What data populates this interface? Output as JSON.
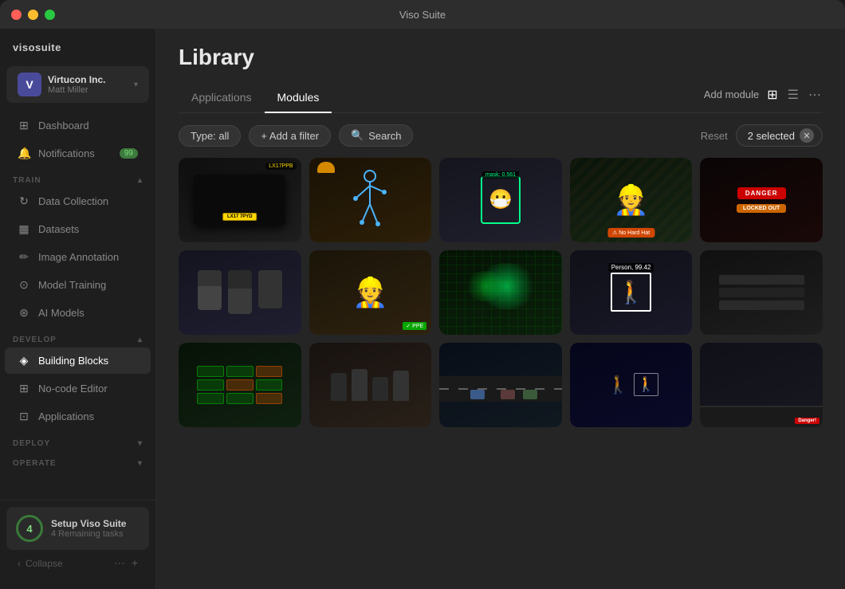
{
  "titlebar": {
    "title": "Viso Suite",
    "buttons": [
      "close",
      "minimize",
      "maximize"
    ]
  },
  "sidebar": {
    "logo": "visosuite",
    "user": {
      "name": "Virtucon Inc.",
      "sub": "Matt Miller",
      "avatar": "V"
    },
    "nav": [
      {
        "id": "dashboard",
        "label": "Dashboard",
        "icon": "⊞"
      },
      {
        "id": "notifications",
        "label": "Notifications",
        "icon": "🔔",
        "badge": "99"
      }
    ],
    "sections": [
      {
        "id": "train",
        "label": "TRAIN",
        "items": [
          {
            "id": "data-collection",
            "label": "Data Collection",
            "icon": "⟳"
          },
          {
            "id": "datasets",
            "label": "Datasets",
            "icon": "▦"
          },
          {
            "id": "image-annotation",
            "label": "Image Annotation",
            "icon": "✏"
          },
          {
            "id": "model-training",
            "label": "Model Training",
            "icon": "⊙"
          },
          {
            "id": "ai-models",
            "label": "AI Models",
            "icon": "⊛"
          }
        ]
      },
      {
        "id": "develop",
        "label": "DEVELOP",
        "items": [
          {
            "id": "building-blocks",
            "label": "Building Blocks",
            "icon": "◈",
            "active": true
          },
          {
            "id": "no-code-editor",
            "label": "No-code Editor",
            "icon": "⊞"
          },
          {
            "id": "applications",
            "label": "Applications",
            "icon": "⊡"
          }
        ]
      },
      {
        "id": "deploy",
        "label": "DEPLOY",
        "items": []
      },
      {
        "id": "operate",
        "label": "OPERATE",
        "items": []
      }
    ],
    "setup": {
      "count": "4",
      "title": "Setup Viso Suite",
      "sub": "4 Remaining tasks"
    },
    "collapse_label": "Collapse"
  },
  "main": {
    "title": "Library",
    "tabs": [
      {
        "id": "applications",
        "label": "Applications",
        "active": false
      },
      {
        "id": "modules",
        "label": "Modules",
        "active": true
      }
    ],
    "add_module_label": "Add module",
    "filters": {
      "type_label": "Type: all",
      "add_filter_label": "+ Add a filter",
      "search_label": "Search",
      "reset_label": "Reset",
      "selected_label": "2 selected"
    },
    "grid": {
      "rows": [
        [
          {
            "id": "car-lpr",
            "type": "dark-car",
            "has_plate": true
          },
          {
            "id": "skeleton",
            "type": "construction",
            "has_skeleton": true
          },
          {
            "id": "face-mask",
            "type": "face",
            "has_face": true
          },
          {
            "id": "ppe-worker",
            "type": "worker",
            "has_ppe": true
          },
          {
            "id": "danger-sign",
            "type": "danger",
            "has_danger": true
          }
        ],
        [
          {
            "id": "office-people",
            "type": "office"
          },
          {
            "id": "hardhat-worker",
            "type": "hardhat"
          },
          {
            "id": "heatmap",
            "type": "heatmap"
          },
          {
            "id": "person-detection",
            "type": "person-det",
            "has_person_box": true
          },
          {
            "id": "warehouse",
            "type": "warehouse"
          }
        ],
        [
          {
            "id": "parking",
            "type": "parking",
            "has_grid": true
          },
          {
            "id": "meeting",
            "type": "meeting"
          },
          {
            "id": "traffic",
            "type": "traffic"
          },
          {
            "id": "pedestrian",
            "type": "pedestrian"
          },
          {
            "id": "railway",
            "type": "railway"
          }
        ]
      ]
    }
  }
}
